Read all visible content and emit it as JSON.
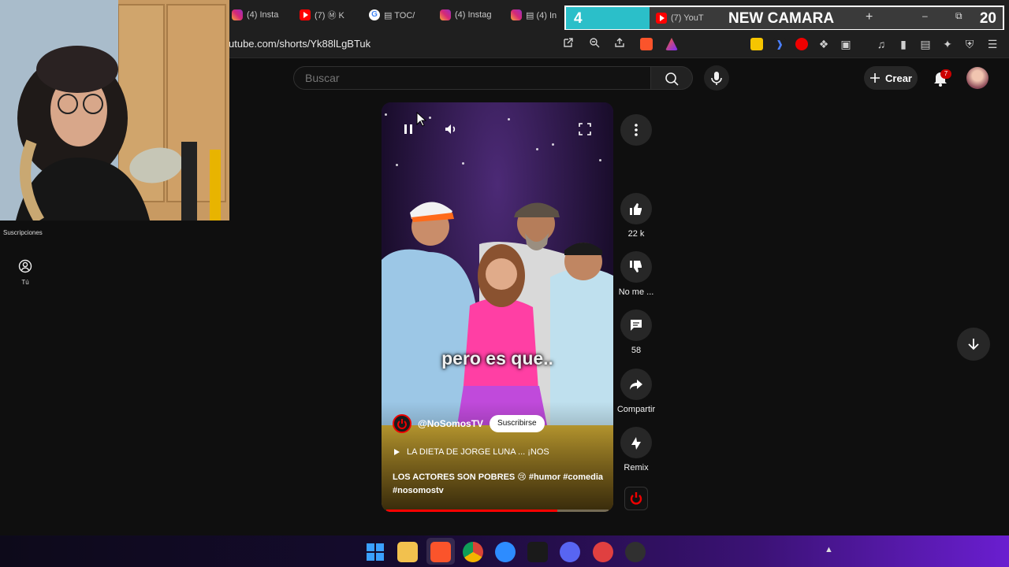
{
  "browser": {
    "tabs": [
      {
        "icon": "instagram",
        "label": "(4) Insta"
      },
      {
        "icon": "youtube",
        "label": "(7) Ⓜ K"
      },
      {
        "icon": "google",
        "label": "▤ TOC/"
      },
      {
        "icon": "instagram",
        "label": "(4) Instag"
      },
      {
        "icon": "instagram",
        "label": "▤ (4) In"
      },
      {
        "icon": "youtube",
        "label": "(7) YouT"
      }
    ],
    "new_tab": "+",
    "window_min": "–",
    "window_restore": "⧉",
    "url": "utube.com/shorts/Yk88lLgBTuk"
  },
  "stream_overlay": {
    "number": "4",
    "title": "NEW CAMARA",
    "right_number": "20"
  },
  "youtube": {
    "search_placeholder": "Buscar",
    "create_label": "Crear",
    "notifications_count": "7",
    "sidebar": {
      "subscriptions_label": "Suscripciones",
      "you_label": "Tú"
    }
  },
  "short": {
    "caption": "pero es que..",
    "channel": "@NoSomosTV",
    "subscribe_label": "Suscribirse",
    "playlist_title": "LA DIETA DE JORGE LUNA ... ¡NOS",
    "description_text": "LOS ACTORES SON POBRES 😢",
    "hashtags": [
      "#humor",
      "#comedia",
      "#nosomostv"
    ],
    "progress_fraction": 0.77
  },
  "actions": {
    "like_count": "22 k",
    "dislike_label": "No me ...",
    "comments_count": "58",
    "share_label": "Compartir",
    "remix_label": "Remix"
  },
  "colors": {
    "youtube_red": "#ff0000",
    "accent_cyan": "#2bbfc9",
    "page_bg": "#0f0f0f",
    "button_bg": "#272727"
  },
  "icons": {
    "pause": "pause-icon",
    "volume": "volume-icon",
    "fullscreen": "fullscreen-icon",
    "more": "more-vertical-icon",
    "like": "thumbs-up-icon",
    "dislike": "thumbs-down-icon",
    "comments": "comment-icon",
    "share": "share-icon",
    "remix": "remix-icon",
    "next": "arrow-down-icon"
  }
}
